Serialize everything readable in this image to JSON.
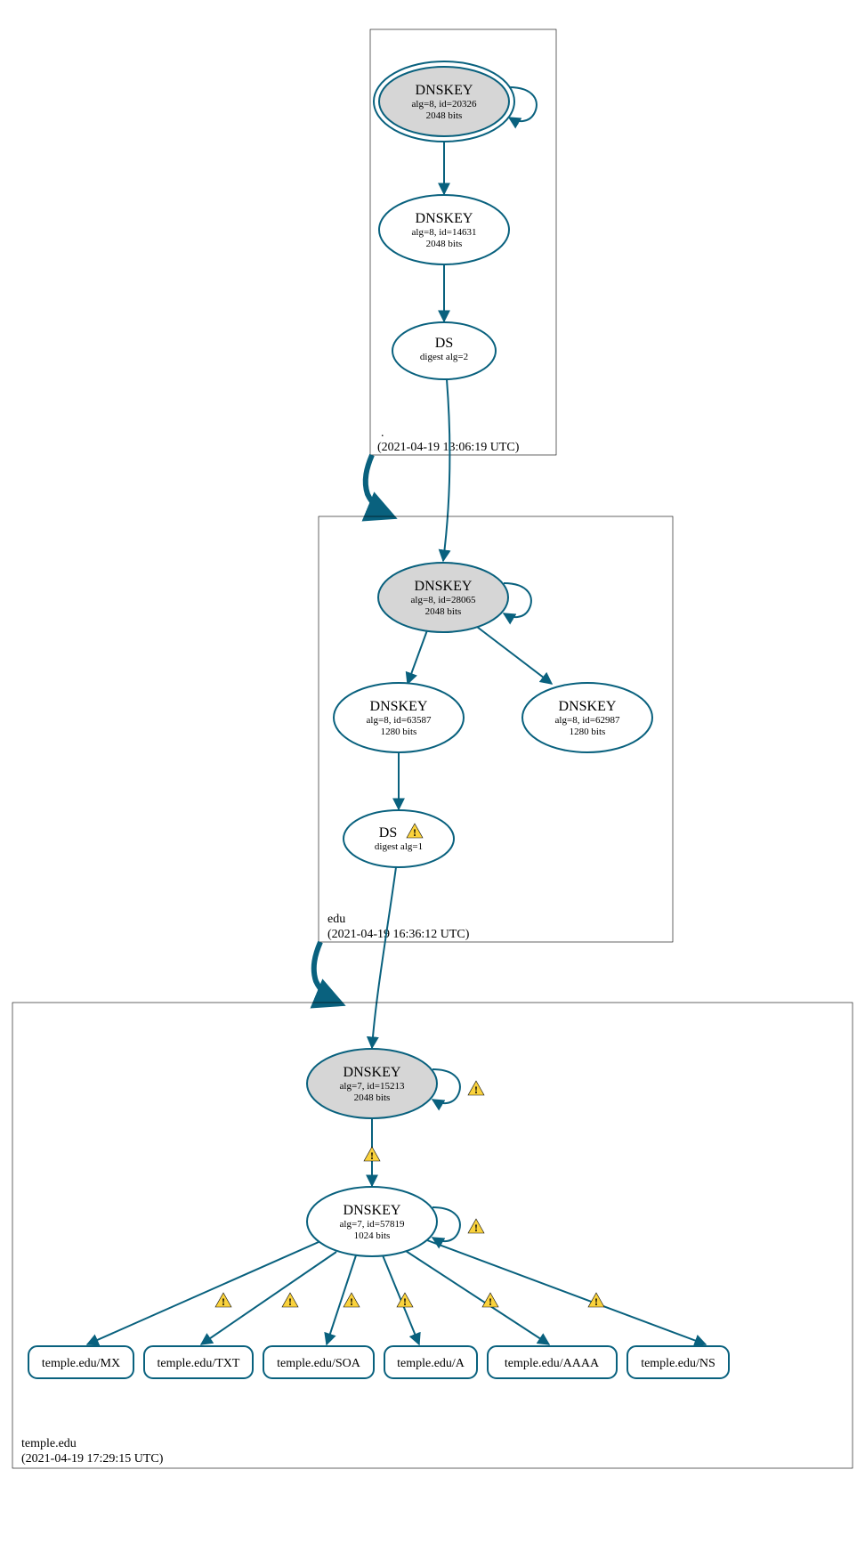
{
  "zones": {
    "root": {
      "name": ".",
      "timestamp": "(2021-04-19 13:06:19 UTC)",
      "keys": {
        "ksk": {
          "title": "DNSKEY",
          "line1": "alg=8, id=20326",
          "line2": "2048 bits"
        },
        "zsk": {
          "title": "DNSKEY",
          "line1": "alg=8, id=14631",
          "line2": "2048 bits"
        }
      },
      "ds": {
        "title": "DS",
        "line1": "digest alg=2"
      }
    },
    "edu": {
      "name": "edu",
      "timestamp": "(2021-04-19 16:36:12 UTC)",
      "keys": {
        "ksk": {
          "title": "DNSKEY",
          "line1": "alg=8, id=28065",
          "line2": "2048 bits"
        },
        "zsk1": {
          "title": "DNSKEY",
          "line1": "alg=8, id=63587",
          "line2": "1280 bits"
        },
        "zsk2": {
          "title": "DNSKEY",
          "line1": "alg=8, id=62987",
          "line2": "1280 bits"
        }
      },
      "ds": {
        "title": "DS",
        "line1": "digest alg=1"
      }
    },
    "temple": {
      "name": "temple.edu",
      "timestamp": "(2021-04-19 17:29:15 UTC)",
      "keys": {
        "ksk": {
          "title": "DNSKEY",
          "line1": "alg=7, id=15213",
          "line2": "2048 bits"
        },
        "zsk": {
          "title": "DNSKEY",
          "line1": "alg=7, id=57819",
          "line2": "1024 bits"
        }
      }
    }
  },
  "rr": {
    "mx": "temple.edu/MX",
    "txt": "temple.edu/TXT",
    "soa": "temple.edu/SOA",
    "a": "temple.edu/A",
    "aaaa": "temple.edu/AAAA",
    "ns": "temple.edu/NS"
  },
  "chart_data": {
    "type": "diagram",
    "description": "DNSSEC delegation / signature chain",
    "zones": [
      {
        "name": ".",
        "analyzed": "2021-04-19 13:06:19 UTC",
        "dnskeys": [
          {
            "id": 20326,
            "alg": 8,
            "bits": 2048,
            "role": "KSK",
            "self_sign": true
          },
          {
            "id": 14631,
            "alg": 8,
            "bits": 2048,
            "role": "ZSK"
          }
        ],
        "ds_records": [
          {
            "digest_alg": 2,
            "signs_zone": "edu"
          }
        ]
      },
      {
        "name": "edu",
        "analyzed": "2021-04-19 16:36:12 UTC",
        "dnskeys": [
          {
            "id": 28065,
            "alg": 8,
            "bits": 2048,
            "role": "KSK",
            "self_sign": true
          },
          {
            "id": 63587,
            "alg": 8,
            "bits": 1280,
            "role": "ZSK"
          },
          {
            "id": 62987,
            "alg": 8,
            "bits": 1280,
            "role": "ZSK"
          }
        ],
        "ds_records": [
          {
            "digest_alg": 1,
            "signs_zone": "temple.edu",
            "warning": true
          }
        ]
      },
      {
        "name": "temple.edu",
        "analyzed": "2021-04-19 17:29:15 UTC",
        "dnskeys": [
          {
            "id": 15213,
            "alg": 7,
            "bits": 2048,
            "role": "KSK",
            "self_sign": true,
            "warning": true
          },
          {
            "id": 57819,
            "alg": 7,
            "bits": 1024,
            "role": "ZSK",
            "self_sign": true,
            "warning": true
          }
        ],
        "signed_rrsets": [
          {
            "name": "temple.edu",
            "type": "MX",
            "warning": true
          },
          {
            "name": "temple.edu",
            "type": "TXT",
            "warning": true
          },
          {
            "name": "temple.edu",
            "type": "SOA",
            "warning": true
          },
          {
            "name": "temple.edu",
            "type": "A",
            "warning": true
          },
          {
            "name": "temple.edu",
            "type": "AAAA",
            "warning": true
          },
          {
            "name": "temple.edu",
            "type": "NS",
            "warning": true
          }
        ]
      }
    ],
    "edges": [
      {
        "from": "./DNSKEY/20326",
        "to": "./DNSKEY/20326"
      },
      {
        "from": "./DNSKEY/20326",
        "to": "./DNSKEY/14631"
      },
      {
        "from": "./DNSKEY/14631",
        "to": "./DS(edu)"
      },
      {
        "from": "./DS(edu)",
        "to": "edu/DNSKEY/28065"
      },
      {
        "from": "edu/DNSKEY/28065",
        "to": "edu/DNSKEY/28065"
      },
      {
        "from": "edu/DNSKEY/28065",
        "to": "edu/DNSKEY/63587"
      },
      {
        "from": "edu/DNSKEY/28065",
        "to": "edu/DNSKEY/62987"
      },
      {
        "from": "edu/DNSKEY/63587",
        "to": "edu/DS(temple.edu)"
      },
      {
        "from": "edu/DS(temple.edu)",
        "to": "temple.edu/DNSKEY/15213"
      },
      {
        "from": "temple.edu/DNSKEY/15213",
        "to": "temple.edu/DNSKEY/15213",
        "warning": true
      },
      {
        "from": "temple.edu/DNSKEY/15213",
        "to": "temple.edu/DNSKEY/57819",
        "warning": true
      },
      {
        "from": "temple.edu/DNSKEY/57819",
        "to": "temple.edu/DNSKEY/57819",
        "warning": true
      },
      {
        "from": "temple.edu/DNSKEY/57819",
        "to": "temple.edu/MX",
        "warning": true
      },
      {
        "from": "temple.edu/DNSKEY/57819",
        "to": "temple.edu/TXT",
        "warning": true
      },
      {
        "from": "temple.edu/DNSKEY/57819",
        "to": "temple.edu/SOA",
        "warning": true
      },
      {
        "from": "temple.edu/DNSKEY/57819",
        "to": "temple.edu/A",
        "warning": true
      },
      {
        "from": "temple.edu/DNSKEY/57819",
        "to": "temple.edu/AAAA",
        "warning": true
      },
      {
        "from": "temple.edu/DNSKEY/57819",
        "to": "temple.edu/NS",
        "warning": true
      }
    ]
  }
}
